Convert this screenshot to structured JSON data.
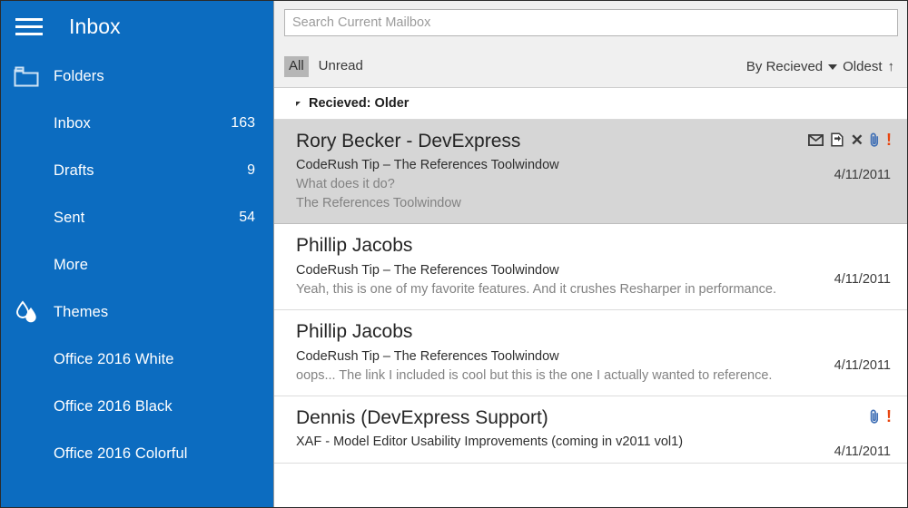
{
  "sidebar": {
    "menu_icon": "hamburger-icon",
    "title": "Inbox",
    "accent_color": "#0c6cc0",
    "groups": [
      {
        "icon": "folder-icon",
        "label": "Folders",
        "items": [
          {
            "label": "Inbox",
            "count": "163"
          },
          {
            "label": "Drafts",
            "count": "9"
          },
          {
            "label": "Sent",
            "count": "54"
          },
          {
            "label": "More",
            "count": ""
          }
        ]
      },
      {
        "icon": "droplet-icon",
        "label": "Themes",
        "items": [
          {
            "label": "Office 2016 White",
            "count": ""
          },
          {
            "label": "Office 2016 Black",
            "count": ""
          },
          {
            "label": "Office 2016 Colorful",
            "count": ""
          }
        ]
      }
    ]
  },
  "search": {
    "value": "",
    "placeholder": "Search Current Mailbox"
  },
  "filter_bar": {
    "all_label": "All",
    "unread_label": "Unread",
    "sort_by_label": "By Recieved",
    "sort_order_label": "Oldest",
    "sort_order_arrow": "↑"
  },
  "group_header": {
    "label": "Recieved: Older"
  },
  "messages": [
    {
      "sender": "Rory Becker - DevExpress",
      "subject": "CodeRush Tip – The References Toolwindow",
      "preview_line1": "What does it do?",
      "preview_line2": "The References Toolwindow",
      "date": "4/11/2011",
      "selected": true,
      "icons": [
        "envelope-icon",
        "move-to-folder-icon",
        "delete-icon",
        "attachment-icon",
        "high-importance-icon"
      ]
    },
    {
      "sender": "Phillip Jacobs",
      "subject": "CodeRush Tip – The References Toolwindow",
      "preview_line1": "Yeah, this is one of my favorite features.  And it crushes Resharper in performance.",
      "preview_line2": "",
      "date": "4/11/2011",
      "selected": false,
      "icons": []
    },
    {
      "sender": "Phillip Jacobs",
      "subject": "CodeRush Tip – The References Toolwindow",
      "preview_line1": "oops...  The link I included is cool but this is the one I actually wanted to reference.",
      "preview_line2": "",
      "date": "4/11/2011",
      "selected": false,
      "icons": []
    },
    {
      "sender": "Dennis (DevExpress Support)",
      "subject": "XAF - Model Editor Usability Improvements (coming in v2011 vol1)",
      "preview_line1": "",
      "preview_line2": "",
      "date": "4/11/2011",
      "selected": false,
      "icons": [
        "attachment-icon",
        "high-importance-icon"
      ]
    }
  ],
  "colors": {
    "accent": "#0c6cc0",
    "selected_row": "#d6d6d6",
    "toolbar": "#f0f0f0",
    "chip_active": "#b6b6b6",
    "importance": "#e8450f",
    "attachment": "#3f6fb5"
  }
}
